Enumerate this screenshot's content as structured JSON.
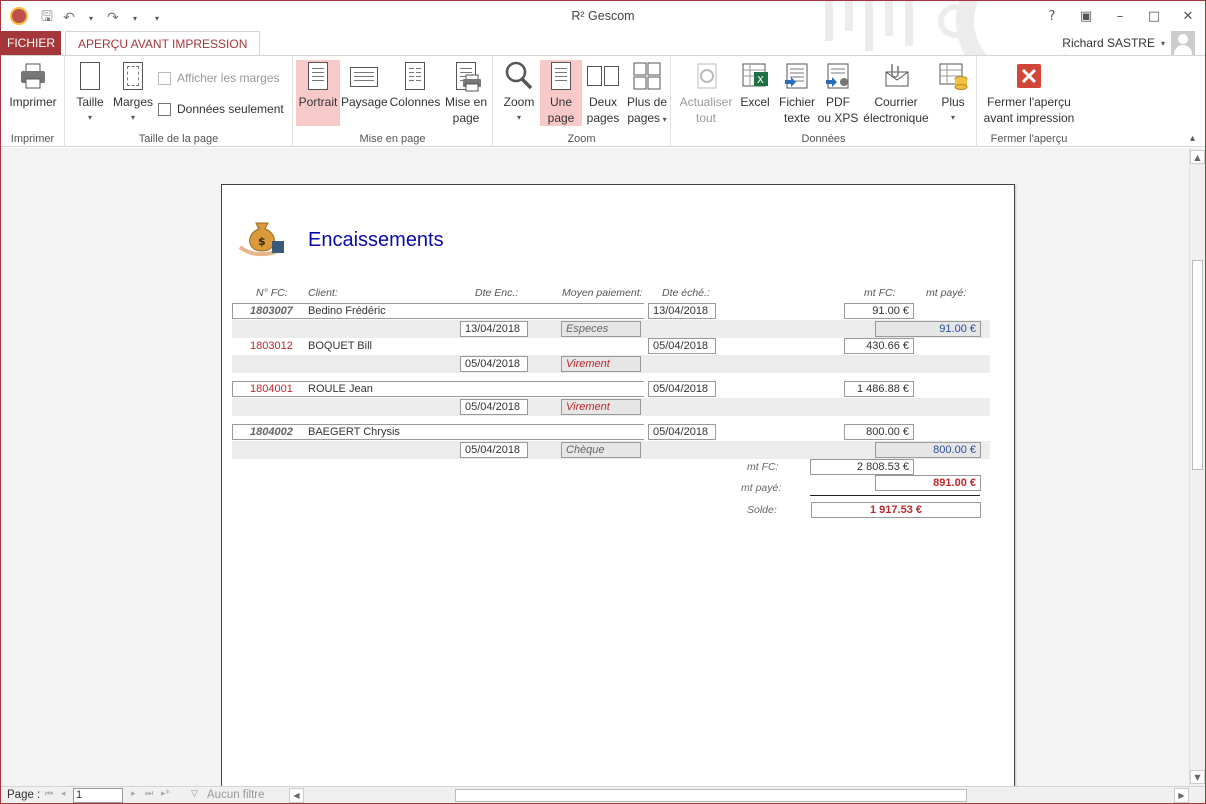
{
  "window": {
    "title": "R² Gescom"
  },
  "tabs": {
    "file": "FICHIER",
    "active": "APERÇU AVANT IMPRESSION"
  },
  "user": {
    "name": "Richard SASTRE"
  },
  "ribbon": {
    "groups": {
      "imprimer": "Imprimer",
      "taille": "Taille de la page",
      "mise": "Mise en page",
      "zoom": "Zoom",
      "donnees": "Données",
      "fermer": "Fermer l'aperçu"
    },
    "buttons": {
      "imprimer": "Imprimer",
      "taille": "Taille",
      "marges": "Marges",
      "afficher_marges": "Afficher les marges",
      "donnees_seulement": "Données seulement",
      "portrait": "Portrait",
      "paysage": "Paysage",
      "colonnes": "Colonnes",
      "mise_en_page_1": "Mise en",
      "mise_en_page_2": "page",
      "zoom": "Zoom",
      "une_page_1": "Une",
      "une_page_2": "page",
      "deux_pages_1": "Deux",
      "deux_pages_2": "pages",
      "plus_pages_1": "Plus de",
      "plus_pages_2": "pages",
      "actualiser_1": "Actualiser",
      "actualiser_2": "tout",
      "excel": "Excel",
      "fichier_texte_1": "Fichier",
      "fichier_texte_2": "texte",
      "pdf_1": "PDF",
      "pdf_2": "ou XPS",
      "courrier_1": "Courrier",
      "courrier_2": "électronique",
      "plus": "Plus",
      "fermer_1": "Fermer l'aperçu",
      "fermer_2": "avant impression"
    }
  },
  "report": {
    "title": "Encaissements",
    "headers": {
      "nfc": "N° FC:",
      "client": "Client:",
      "dte_enc": "Dte Enc.:",
      "moyen": "Moyen paiement:",
      "dte_eche": "Dte éché.:",
      "mt_fc": "mt FC:",
      "mt_paye": "mt payé:"
    },
    "rows": [
      {
        "nfc": "1803007",
        "client": "Bedino Frédéric",
        "dte_eche": "13/04/2018",
        "mt_fc": "91.00 €",
        "dte_enc": "13/04/2018",
        "moyen": "Especes",
        "mt_paye": "91.00 €"
      },
      {
        "nfc": "1803012",
        "client": "BOQUET Bill",
        "dte_eche": "05/04/2018",
        "mt_fc": "430.66 €",
        "dte_enc": "05/04/2018",
        "moyen": "Virement",
        "mt_paye": ""
      },
      {
        "nfc": "1804001",
        "client": "ROULE Jean",
        "dte_eche": "05/04/2018",
        "mt_fc": "1 486.88 €",
        "dte_enc": "05/04/2018",
        "moyen": "Virement",
        "mt_paye": ""
      },
      {
        "nfc": "1804002",
        "client": "BAEGERT Chrysis",
        "dte_eche": "05/04/2018",
        "mt_fc": "800.00 €",
        "dte_enc": "05/04/2018",
        "moyen": "Chèque",
        "mt_paye": "800.00 €"
      }
    ],
    "totals": {
      "mt_fc_label": "mt FC:",
      "mt_fc": "2 808.53 €",
      "mt_paye_label": "mt payé:",
      "mt_paye": "891.00 €",
      "solde_label": "Solde:",
      "solde": "1 917.53 €"
    }
  },
  "status": {
    "page_label": "Page :",
    "page_value": "1",
    "filter": "Aucun filtre"
  }
}
